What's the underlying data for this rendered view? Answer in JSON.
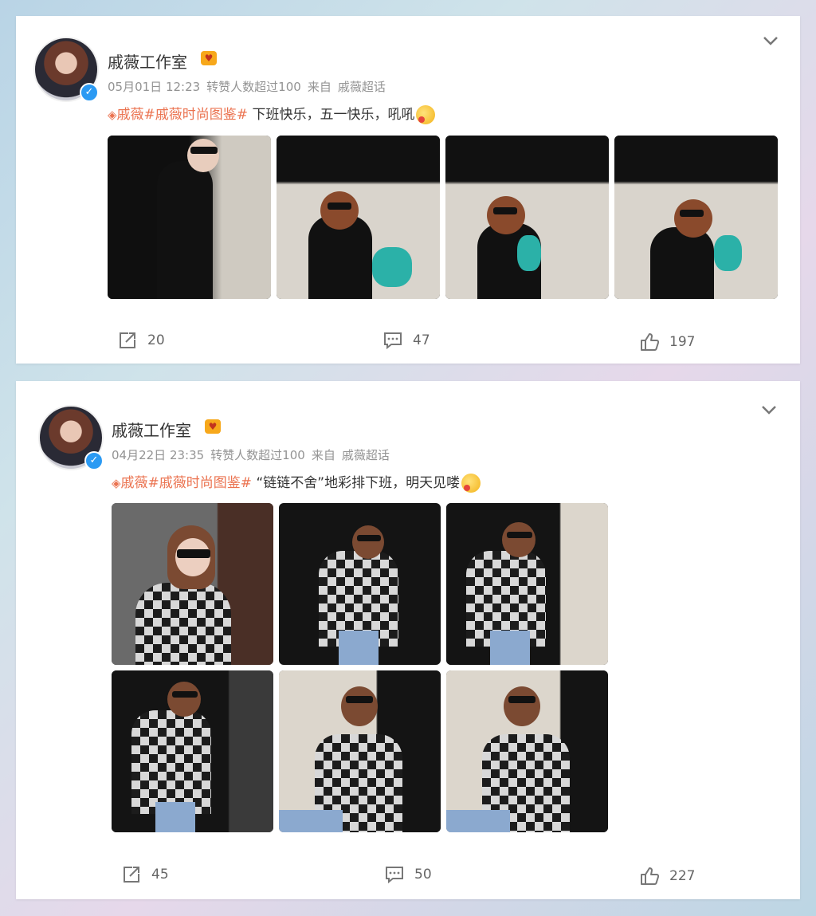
{
  "posts": [
    {
      "author": "戚薇工作室",
      "date": "05月01日 12:23",
      "repost_note": "转赞人数超过100",
      "source_prefix": "来自",
      "source": "戚薇超话",
      "tag1": "戚薇",
      "tag2": "#戚薇时尚图鉴#",
      "text": " 下班快乐，五一快乐，吼吼",
      "stats": {
        "repost": "20",
        "comment": "47",
        "like": "197"
      },
      "photos": [
        {
          "desc": "black jacket, sunglasses, waving, indoor"
        },
        {
          "desc": "black jacket, sunglasses, in car"
        },
        {
          "desc": "black jacket, sunglasses, waving in car"
        },
        {
          "desc": "black jacket, sunglasses, waving in car"
        }
      ]
    },
    {
      "author": "戚薇工作室",
      "date": "04月22日 23:35",
      "repost_note": "转赞人数超过100",
      "source_prefix": "来自",
      "source": "戚薇超话",
      "tag1": "戚薇",
      "tag2": "#戚薇时尚图鉴#",
      "text": " “链链不舍”地彩排下班，明天见喽",
      "stats": {
        "repost": "45",
        "comment": "50",
        "like": "227"
      },
      "photos": [
        {
          "desc": "plaid shirt, sunglasses, brick wall"
        },
        {
          "desc": "plaid shirt, waving, night"
        },
        {
          "desc": "plaid shirt, waving, by car"
        },
        {
          "desc": "plaid shirt, waving, by car door"
        },
        {
          "desc": "plaid shirt, seated in car"
        },
        {
          "desc": "plaid shirt, seated in car"
        }
      ]
    }
  ],
  "colors": {
    "tag": "#eb7350",
    "verified": "#2b9af3",
    "meta": "#939393"
  }
}
